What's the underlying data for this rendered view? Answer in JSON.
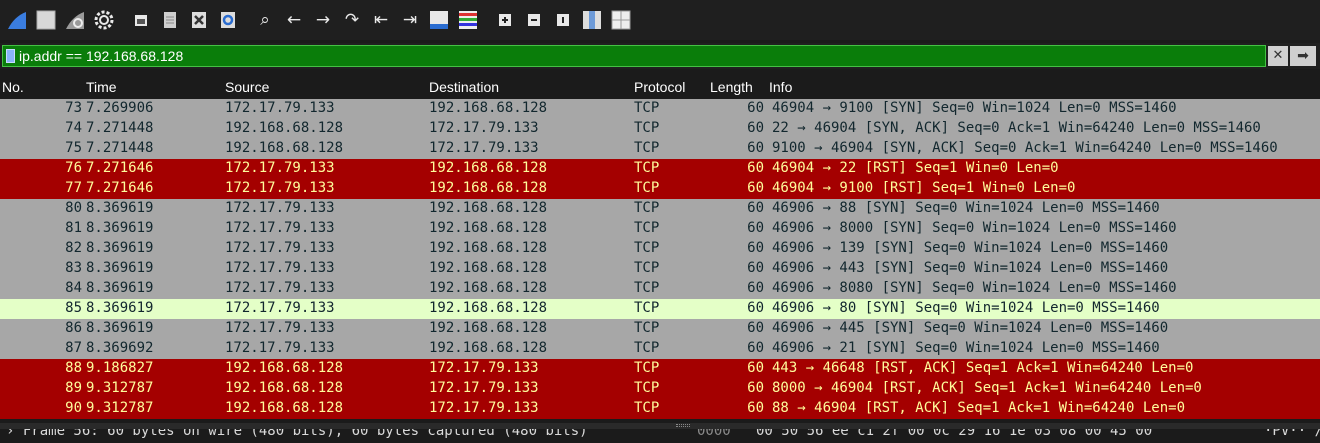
{
  "toolbar": {
    "icons": [
      "shark-fin-icon",
      "stop-square-icon",
      "restart-fin-icon",
      "gear-icon",
      "open-file-icon",
      "save-file-icon",
      "close-file-icon",
      "reload-icon",
      "search-icon",
      "back-arrow-icon",
      "forward-arrow-icon",
      "jump-to-packet-icon",
      "first-packet-icon",
      "last-packet-icon",
      "autoscroll-icon",
      "colorize-icon",
      "zoom-in-icon",
      "zoom-out-icon",
      "normal-size-icon",
      "resize-columns-icon",
      "number-grid-icon"
    ]
  },
  "filter": {
    "value": "ip.addr == 192.168.68.128"
  },
  "columns": {
    "no": "No.",
    "time": "Time",
    "source": "Source",
    "destination": "Destination",
    "protocol": "Protocol",
    "length": "Length",
    "info": "Info"
  },
  "packets": [
    {
      "no": "73",
      "time": "7.269906",
      "src": "172.17.79.133",
      "dst": "192.168.68.128",
      "proto": "TCP",
      "len": "60",
      "info": "46904 → 9100 [SYN] Seq=0 Win=1024 Len=0 MSS=1460",
      "style": "tcp"
    },
    {
      "no": "74",
      "time": "7.271448",
      "src": "192.168.68.128",
      "dst": "172.17.79.133",
      "proto": "TCP",
      "len": "60",
      "info": "22 → 46904 [SYN, ACK] Seq=0 Ack=1 Win=64240 Len=0 MSS=1460",
      "style": "tcp"
    },
    {
      "no": "75",
      "time": "7.271448",
      "src": "192.168.68.128",
      "dst": "172.17.79.133",
      "proto": "TCP",
      "len": "60",
      "info": "9100 → 46904 [SYN, ACK] Seq=0 Ack=1 Win=64240 Len=0 MSS=1460",
      "style": "tcp"
    },
    {
      "no": "76",
      "time": "7.271646",
      "src": "172.17.79.133",
      "dst": "192.168.68.128",
      "proto": "TCP",
      "len": "60",
      "info": "46904 → 22 [RST] Seq=1 Win=0 Len=0",
      "style": "rst"
    },
    {
      "no": "77",
      "time": "7.271646",
      "src": "172.17.79.133",
      "dst": "192.168.68.128",
      "proto": "TCP",
      "len": "60",
      "info": "46904 → 9100 [RST] Seq=1 Win=0 Len=0",
      "style": "rst"
    },
    {
      "no": "80",
      "time": "8.369619",
      "src": "172.17.79.133",
      "dst": "192.168.68.128",
      "proto": "TCP",
      "len": "60",
      "info": "46906 → 88 [SYN] Seq=0 Win=1024 Len=0 MSS=1460",
      "style": "tcp"
    },
    {
      "no": "81",
      "time": "8.369619",
      "src": "172.17.79.133",
      "dst": "192.168.68.128",
      "proto": "TCP",
      "len": "60",
      "info": "46906 → 8000 [SYN] Seq=0 Win=1024 Len=0 MSS=1460",
      "style": "tcp"
    },
    {
      "no": "82",
      "time": "8.369619",
      "src": "172.17.79.133",
      "dst": "192.168.68.128",
      "proto": "TCP",
      "len": "60",
      "info": "46906 → 139 [SYN] Seq=0 Win=1024 Len=0 MSS=1460",
      "style": "tcp"
    },
    {
      "no": "83",
      "time": "8.369619",
      "src": "172.17.79.133",
      "dst": "192.168.68.128",
      "proto": "TCP",
      "len": "60",
      "info": "46906 → 443 [SYN] Seq=0 Win=1024 Len=0 MSS=1460",
      "style": "tcp"
    },
    {
      "no": "84",
      "time": "8.369619",
      "src": "172.17.79.133",
      "dst": "192.168.68.128",
      "proto": "TCP",
      "len": "60",
      "info": "46906 → 8080 [SYN] Seq=0 Win=1024 Len=0 MSS=1460",
      "style": "tcp"
    },
    {
      "no": "85",
      "time": "8.369619",
      "src": "172.17.79.133",
      "dst": "192.168.68.128",
      "proto": "TCP",
      "len": "60",
      "info": "46906 → 80 [SYN] Seq=0 Win=1024 Len=0 MSS=1460",
      "style": "sel"
    },
    {
      "no": "86",
      "time": "8.369619",
      "src": "172.17.79.133",
      "dst": "192.168.68.128",
      "proto": "TCP",
      "len": "60",
      "info": "46906 → 445 [SYN] Seq=0 Win=1024 Len=0 MSS=1460",
      "style": "tcp"
    },
    {
      "no": "87",
      "time": "8.369692",
      "src": "172.17.79.133",
      "dst": "192.168.68.128",
      "proto": "TCP",
      "len": "60",
      "info": "46906 → 21 [SYN] Seq=0 Win=1024 Len=0 MSS=1460",
      "style": "tcp"
    },
    {
      "no": "88",
      "time": "9.186827",
      "src": "192.168.68.128",
      "dst": "172.17.79.133",
      "proto": "TCP",
      "len": "60",
      "info": "443 → 46648 [RST, ACK] Seq=1 Ack=1 Win=64240 Len=0",
      "style": "rst"
    },
    {
      "no": "89",
      "time": "9.312787",
      "src": "192.168.68.128",
      "dst": "172.17.79.133",
      "proto": "TCP",
      "len": "60",
      "info": "8000 → 46904 [RST, ACK] Seq=1 Ack=1 Win=64240 Len=0",
      "style": "rst"
    },
    {
      "no": "90",
      "time": "9.312787",
      "src": "192.168.68.128",
      "dst": "172.17.79.133",
      "proto": "TCP",
      "len": "60",
      "info": "88 → 46904 [RST, ACK] Seq=1 Ack=1 Win=64240 Len=0",
      "style": "rst"
    }
  ],
  "details": {
    "frame_summary": "› Frame 56: 60 bytes on wire (480 bits), 60 bytes captured (480 bits)",
    "offset": "0000",
    "hex": "00 50 56 ee c1 2f 00 0c  29 16 1e 03 08 00 45 00",
    "ascii": "·PV·· /"
  },
  "colors": {
    "tcp_row": "#a7a7a7",
    "rst_row": "#a40000",
    "rst_text": "#fffc9c",
    "selected_row": "#e4ffc7",
    "filter_bg": "#0a7d0a"
  }
}
